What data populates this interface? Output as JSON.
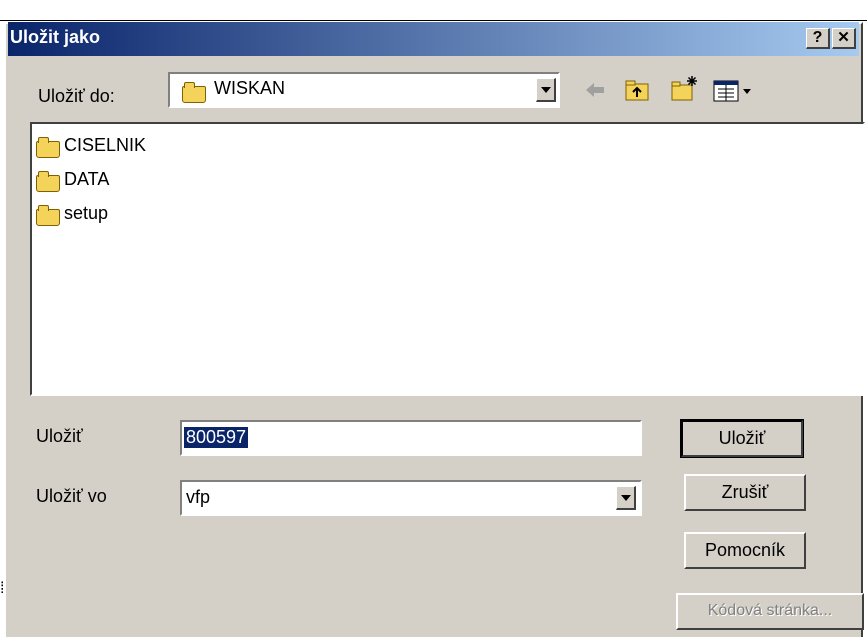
{
  "window": {
    "title": "Uložit jako",
    "help_button": "?",
    "close_button": "✕"
  },
  "location": {
    "label": "Uložiť do:",
    "value": "WISKAN"
  },
  "toolbar": {
    "icons": [
      "back-arrow-icon",
      "up-folder-icon",
      "new-folder-icon",
      "view-menu-icon"
    ]
  },
  "files": [
    {
      "name": "CISELNIK",
      "icon": "folder-icon"
    },
    {
      "name": "DATA",
      "icon": "folder-icon"
    },
    {
      "name": "setup",
      "icon": "folder-icon"
    }
  ],
  "filename": {
    "label": "Uložiť",
    "value": "800597"
  },
  "filetype": {
    "label": "Uložiť vo",
    "value": "vfp"
  },
  "buttons": {
    "save": "Uložiť",
    "cancel": "Zrušiť",
    "help": "Pomocník",
    "codepage": "Kódová stránka..."
  },
  "colors": {
    "title_start": "#0a246a",
    "title_end": "#a6caf0",
    "dialog_bg": "#d4d0c8",
    "selection": "#0a246a"
  }
}
